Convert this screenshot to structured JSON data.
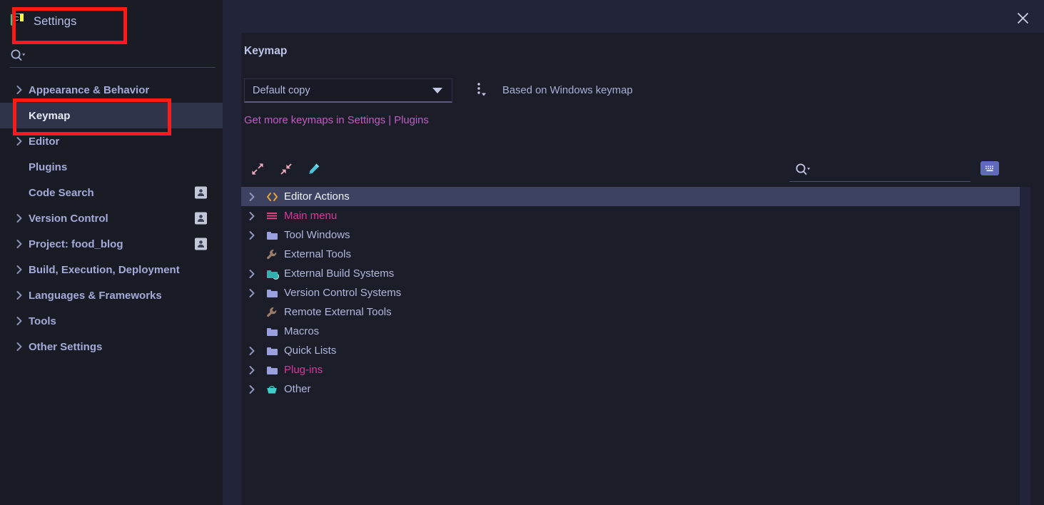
{
  "window": {
    "title": "Settings",
    "logo_icon": "pycharm-logo-icon",
    "close_icon": "close-icon"
  },
  "sidebar": {
    "search": {
      "icon": "search-icon",
      "placeholder": "",
      "value": ""
    },
    "items": [
      {
        "label": "Appearance & Behavior",
        "expandable": true,
        "selected": false,
        "badge": false
      },
      {
        "label": "Keymap",
        "expandable": false,
        "selected": true,
        "badge": false
      },
      {
        "label": "Editor",
        "expandable": true,
        "selected": false,
        "badge": false
      },
      {
        "label": "Plugins",
        "expandable": false,
        "selected": false,
        "badge": false
      },
      {
        "label": "Code Search",
        "expandable": false,
        "selected": false,
        "badge": true
      },
      {
        "label": "Version Control",
        "expandable": true,
        "selected": false,
        "badge": true
      },
      {
        "label": "Project: food_blog",
        "expandable": true,
        "selected": false,
        "badge": true
      },
      {
        "label": "Build, Execution, Deployment",
        "expandable": true,
        "selected": false,
        "badge": false
      },
      {
        "label": "Languages & Frameworks",
        "expandable": true,
        "selected": false,
        "badge": false
      },
      {
        "label": "Tools",
        "expandable": true,
        "selected": false,
        "badge": false
      },
      {
        "label": "Other Settings",
        "expandable": true,
        "selected": false,
        "badge": false
      }
    ]
  },
  "main": {
    "page_title": "Keymap",
    "keymap_select": {
      "value": "Default copy",
      "arrow_icon": "chevron-down-icon"
    },
    "kebab_icon": "more-options-icon",
    "based_on": "Based on Windows keymap",
    "plugins_link": "Get more keymaps in Settings | Plugins",
    "toolbar": {
      "expand_all_icon": "expand-all-icon",
      "collapse_all_icon": "collapse-all-icon",
      "edit_icon": "pencil-edit-icon",
      "search_icon": "search-icon",
      "search_value": "",
      "search_placeholder": "",
      "keyboard_icon": "keyboard-shortcut-icon"
    },
    "tree": [
      {
        "label": "Editor Actions",
        "icon": "code-brackets-icon",
        "expandable": true,
        "selected": true,
        "color": "default"
      },
      {
        "label": "Main menu",
        "icon": "menu-lines-icon",
        "expandable": true,
        "selected": false,
        "color": "#d6399b"
      },
      {
        "label": "Tool Windows",
        "icon": "folder-icon",
        "expandable": true,
        "selected": false,
        "color": "default"
      },
      {
        "label": "External Tools",
        "icon": "wrench-icon",
        "expandable": false,
        "selected": false,
        "color": "default"
      },
      {
        "label": "External Build Systems",
        "icon": "folder-gear-icon",
        "expandable": true,
        "selected": false,
        "color": "default"
      },
      {
        "label": "Version Control Systems",
        "icon": "folder-icon",
        "expandable": true,
        "selected": false,
        "color": "default"
      },
      {
        "label": "Remote External Tools",
        "icon": "wrench-icon",
        "expandable": false,
        "selected": false,
        "color": "default"
      },
      {
        "label": "Macros",
        "icon": "folder-icon",
        "expandable": false,
        "selected": false,
        "color": "default"
      },
      {
        "label": "Quick Lists",
        "icon": "folder-icon",
        "expandable": true,
        "selected": false,
        "color": "default"
      },
      {
        "label": "Plug-ins",
        "icon": "folder-icon",
        "expandable": true,
        "selected": false,
        "color": "#d6399b"
      },
      {
        "label": "Other",
        "icon": "basket-icon",
        "expandable": true,
        "selected": false,
        "color": "default"
      }
    ]
  },
  "annotations": [
    {
      "name": "settings-title-highlight",
      "color": "#ff1a1a"
    },
    {
      "name": "keymap-item-highlight",
      "color": "#ff1a1a"
    }
  ],
  "colors": {
    "background": "#1b1d29",
    "sidebar_bg": "#191b25",
    "header_bg": "#22253a",
    "selection": "#3d4260",
    "accent_link": "#c05ec0",
    "text": "#a9b0d6",
    "annotation": "#ff1a1a"
  }
}
